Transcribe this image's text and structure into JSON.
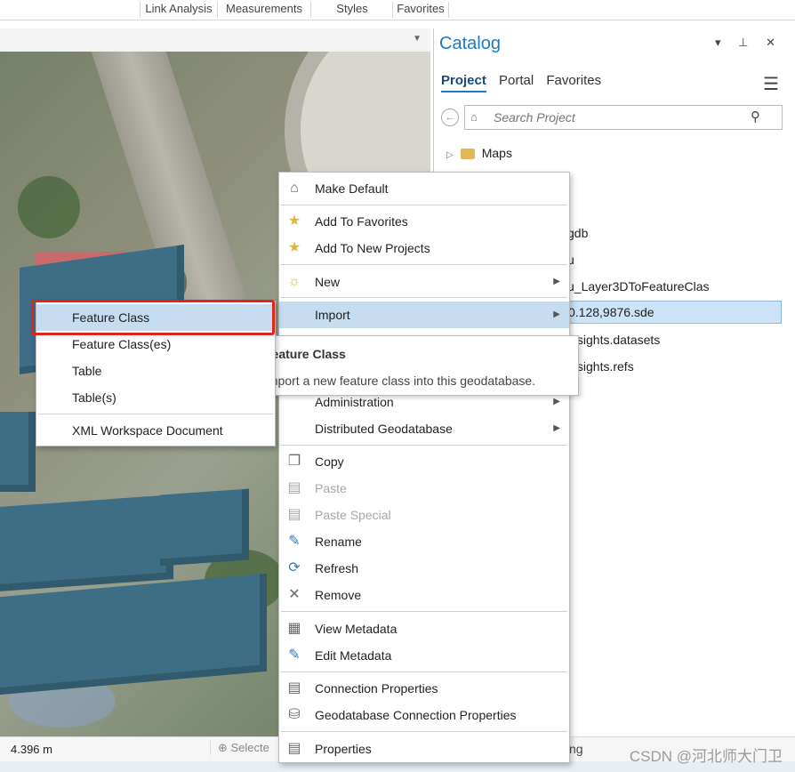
{
  "ribbon": {
    "groups": [
      "Link Analysis",
      "Measurements",
      "Styles",
      "Favorites"
    ]
  },
  "map": {
    "scale_readout": "4.396 m",
    "select_label": "Selecte",
    "status_right": "ng"
  },
  "catalog": {
    "title": "Catalog",
    "window_controls": "▾ ⊥ ✕",
    "tabs": [
      "Project",
      "Portal",
      "Favorites"
    ],
    "active_tab": "Project",
    "search_placeholder": "Search Project",
    "tree": [
      {
        "label": "Maps",
        "type": "folder"
      },
      {
        "label": "gdb",
        "type": "item"
      },
      {
        "label": "u",
        "type": "item"
      },
      {
        "label": "u_Layer3DToFeatureClas",
        "type": "item"
      },
      {
        "label": "0.128,9876.sde",
        "type": "item",
        "selected": true
      },
      {
        "label": "insights.datasets",
        "type": "item"
      },
      {
        "label": "insights.refs",
        "type": "item"
      }
    ]
  },
  "context_menu": {
    "items": [
      {
        "label": "Make Default",
        "icon": "home-icon"
      },
      {
        "label": "Add To Favorites",
        "icon": "star-icon"
      },
      {
        "label": "Add To New Projects",
        "icon": "star-icon"
      },
      {
        "label": "New",
        "icon": "sun-icon",
        "submenu": true
      },
      {
        "label": "Import",
        "icon": "none",
        "submenu": true,
        "highlighted": true
      },
      {
        "label": "Administration",
        "submenu": true
      },
      {
        "label": "Distributed Geodatabase",
        "submenu": true
      },
      {
        "label": "Copy",
        "icon": "copy-icon"
      },
      {
        "label": "Paste",
        "icon": "paste-icon",
        "disabled": true
      },
      {
        "label": "Paste Special",
        "icon": "paste-icon",
        "disabled": true
      },
      {
        "label": "Rename",
        "icon": "pencil-icon"
      },
      {
        "label": "Refresh",
        "icon": "refresh-icon"
      },
      {
        "label": "Remove",
        "icon": "close-icon"
      },
      {
        "label": "View Metadata",
        "icon": "document-icon"
      },
      {
        "label": "Edit Metadata",
        "icon": "pencil-icon"
      },
      {
        "label": "Connection Properties",
        "icon": "properties-icon"
      },
      {
        "label": "Geodatabase Connection Properties",
        "icon": "database-icon"
      },
      {
        "label": "Properties",
        "icon": "properties-icon"
      }
    ]
  },
  "import_submenu": {
    "items": [
      {
        "label": "Feature Class",
        "highlighted": true
      },
      {
        "label": "Feature Class(es)"
      },
      {
        "label": "Table"
      },
      {
        "label": "Table(s)"
      },
      {
        "label": "XML Workspace Document"
      }
    ]
  },
  "tooltip": {
    "title": "Feature Class",
    "description": "Import a new feature class into this geodatabase."
  },
  "watermark": "CSDN @河北师大门卫",
  "colors": {
    "accent": "#1e7bc0",
    "highlight": "#c6dcf0",
    "building": "#3d6e86",
    "annotation_red": "#e0241e"
  }
}
